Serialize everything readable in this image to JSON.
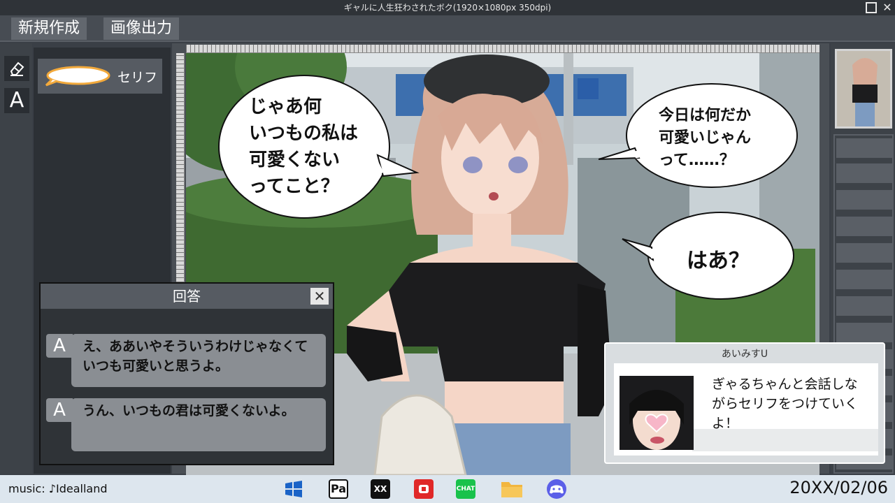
{
  "window": {
    "title": "ギャルに人生狂わされたボク(1920×1080px 350dpi)",
    "close_glyph": "✕"
  },
  "menu": {
    "new_label": "新規作成",
    "export_label": "画像出力"
  },
  "tools": {
    "text_tool_glyph": "A",
    "speech_item_label": "セリフ"
  },
  "speech_bubbles": [
    {
      "lines": [
        "じゃあ何",
        "いつもの私は",
        "可愛くない",
        "ってこと？"
      ]
    },
    {
      "lines": [
        "今日は何だか",
        "可愛いじゃん",
        "って……？"
      ]
    },
    {
      "lines": [
        "はあ？"
      ]
    }
  ],
  "answer_dialog": {
    "title": "回答",
    "close_glyph": "✕",
    "options": [
      {
        "marker": "A",
        "lines": [
          "え、ああいやそういうわけじゃなくて",
          "いつも可愛いと思うよ。"
        ]
      },
      {
        "marker": "A",
        "lines": [
          "うん、いつもの君は可愛くないよ。"
        ]
      }
    ]
  },
  "chat": {
    "name": "あいみすU",
    "lines": [
      "ぎゃるちゃんと会話しな",
      "がらセリフをつけていく",
      "よ！"
    ]
  },
  "taskbar": {
    "music_label": "music: ♪Idealland",
    "date": "20XX/02/06",
    "apps": [
      {
        "icon": "windows-icon"
      },
      {
        "icon": "pa-app-icon",
        "text": "Pa"
      },
      {
        "icon": "xx-app-icon",
        "text": "XX"
      },
      {
        "icon": "red-app-icon"
      },
      {
        "icon": "chat-app-icon",
        "text": "CHAT"
      },
      {
        "icon": "folder-icon"
      },
      {
        "icon": "game-controller-icon"
      }
    ]
  },
  "colors": {
    "ui_dark": "#2c3035",
    "ui_mid": "#565b62",
    "answer_bubble": "#8a8e93",
    "taskbar": "#dde6ee",
    "chat_app": "#19c24b",
    "folder": "#f2b640",
    "controller": "#5b5fe8",
    "windows": "#1a63c7",
    "red_app": "#e02828"
  }
}
